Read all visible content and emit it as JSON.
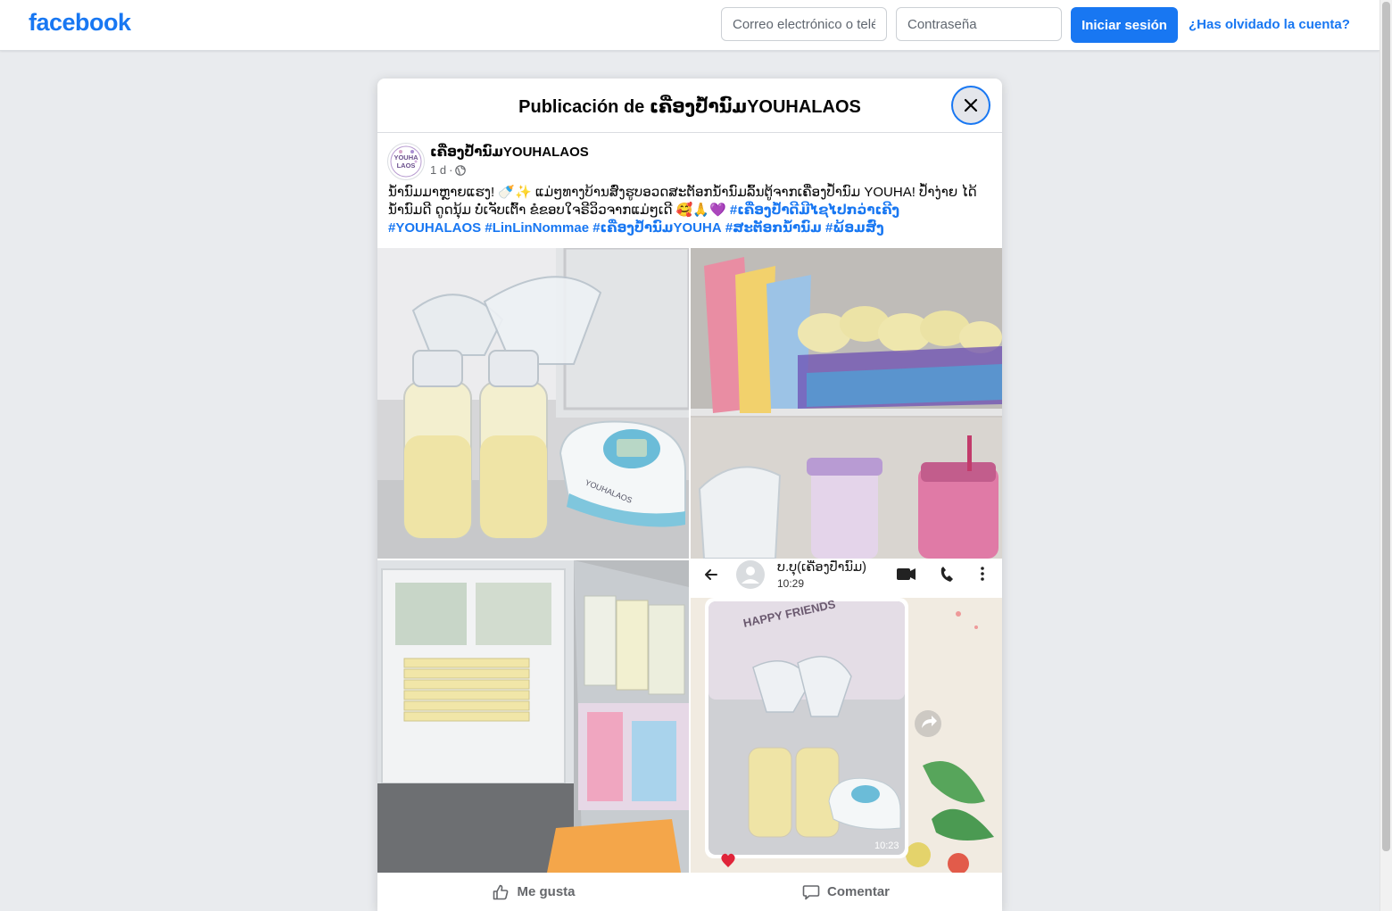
{
  "topbar": {
    "logo": "facebook",
    "email_placeholder": "Correo electrónico o teléfono",
    "password_placeholder": "Contraseña",
    "login_label": "Iniciar sesión",
    "forgot_label": "¿Has olvidado la cuenta?"
  },
  "dialog": {
    "title": "Publicación de ເຄື່ອງປ້ຳນົມYOUHALAOS"
  },
  "post": {
    "author": "ເຄື່ອງປ້ຳນົມYOUHALAOS",
    "avatar_text": "YOUHA LAOS",
    "time": "1 d",
    "text_line1": "ນ້ຳນົມມາຫຼາຍແຮງ! 🍼✨ ແມ່ໆທາງບ້ານສົ່ງຮູບອວດສະຕັອກນ້ຳນົມລົ້ນຕູ້ຈາກເຄື່ອງປ້ຳນົມ YOUHA! ປ້ຳງ່າຍ ໄດ້ນ້ຳນົມດີ ດູດນຸ້ມ ບໍ່ເຈັບເຕົ້າ ຂໍຂອບໃຈຣີວິວຈາກແມ່ໆເດີ 🥰🙏💜",
    "hashtags_inline": [
      "#ເຄື່ອງປ້ຳດີມີໄຊໄປກວ່າເຄີງ"
    ],
    "hashtags": [
      "#YOUHALAOS",
      "#LinLinNommae",
      "#ເຄື່ອງປ້ຳນົມYOUHA",
      "#ສະຕັອກນ້ຳນົມ",
      "#ພ້ອມສົ່ງ"
    ],
    "photo_labels": {
      "pump_brand": "YOUHALAOS",
      "chat_name": "ບ.ບຸ(ເຄື່ອງປ້ຳນົມ)",
      "chat_time": "10:29",
      "chat_image_time": "10:23",
      "sticker_text": "HAPPY FRIENDS"
    },
    "actions": {
      "like": "Me gusta",
      "comment": "Comentar"
    }
  },
  "colors": {
    "brand": "#1877f2",
    "background": "#e9ebee",
    "secondary_text": "#65676b"
  }
}
